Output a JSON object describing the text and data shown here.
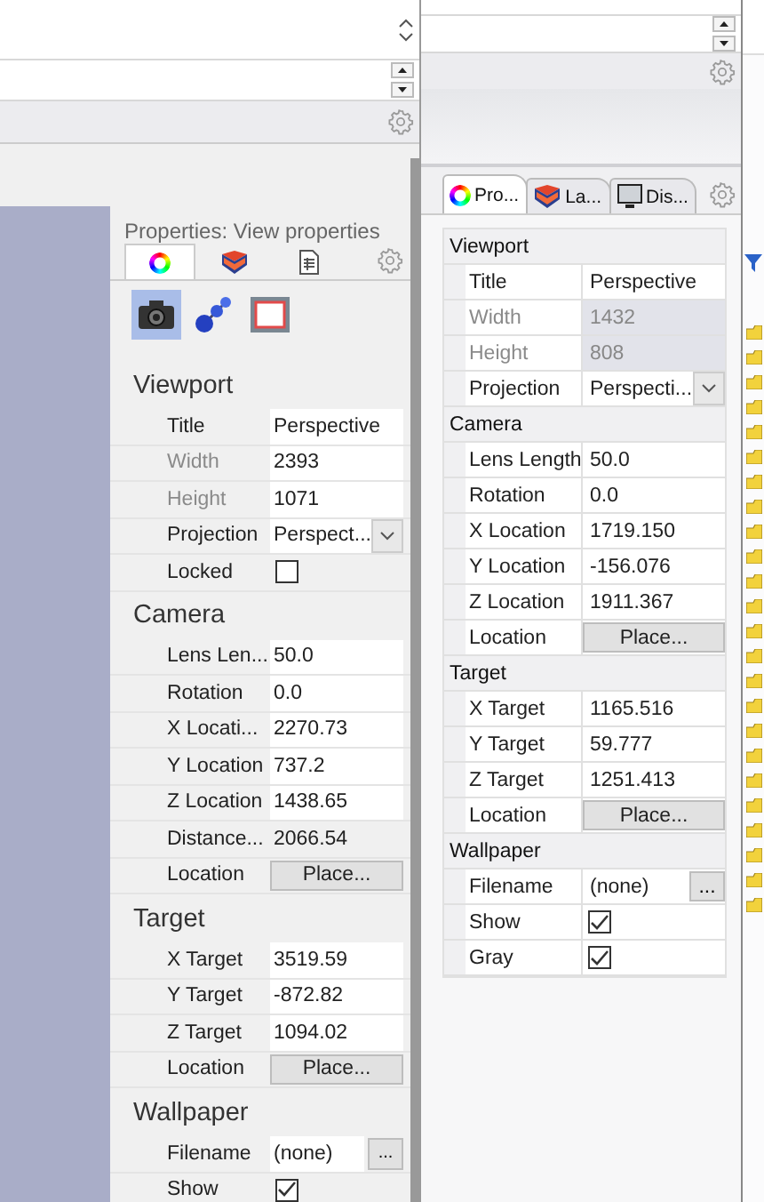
{
  "left": {
    "title": "Properties: View properties",
    "tabs": [
      {
        "selected": true
      },
      {
        "selected": false
      },
      {
        "selected": false
      }
    ],
    "subtabs": [
      {
        "selected": true
      },
      {
        "selected": false
      },
      {
        "selected": false
      }
    ],
    "sections": [
      {
        "header": "Viewport",
        "rows": [
          {
            "label": "Title",
            "kind": "text",
            "value": "Perspective",
            "disabled": false
          },
          {
            "label": "Width",
            "kind": "text",
            "value": "2393",
            "disabled": true
          },
          {
            "label": "Height",
            "kind": "text",
            "value": "1071",
            "disabled": true
          },
          {
            "label": "Projection",
            "kind": "dropdown",
            "value": "Perspect...",
            "disabled": false
          },
          {
            "label": "Locked",
            "kind": "checkbox",
            "checked": false,
            "disabled": false
          }
        ]
      },
      {
        "header": "Camera",
        "rows": [
          {
            "label": "Lens Len...",
            "kind": "text",
            "value": "50.0",
            "disabled": false
          },
          {
            "label": "Rotation",
            "kind": "text",
            "value": "0.0",
            "disabled": false
          },
          {
            "label": "X Locati...",
            "kind": "text",
            "value": "2270.73",
            "disabled": false
          },
          {
            "label": "Y Location",
            "kind": "text",
            "value": "737.2",
            "disabled": false
          },
          {
            "label": "Z Location",
            "kind": "text",
            "value": "1438.65",
            "disabled": false
          },
          {
            "label": "Distance...",
            "kind": "readonly",
            "value": "2066.54",
            "disabled": false
          },
          {
            "label": "Location",
            "kind": "button",
            "value": "Place...",
            "disabled": false
          }
        ]
      },
      {
        "header": "Target",
        "rows": [
          {
            "label": "X Target",
            "kind": "text",
            "value": "3519.59",
            "disabled": false
          },
          {
            "label": "Y Target",
            "kind": "text",
            "value": "-872.82",
            "disabled": false
          },
          {
            "label": "Z Target",
            "kind": "text",
            "value": "1094.02",
            "disabled": false
          },
          {
            "label": "Location",
            "kind": "button",
            "value": "Place...",
            "disabled": false
          }
        ]
      },
      {
        "header": "Wallpaper",
        "rows": [
          {
            "label": "Filename",
            "kind": "file",
            "value": "(none)",
            "button_label": "...",
            "disabled": false
          },
          {
            "label": "Show",
            "kind": "checkbox",
            "checked": true,
            "disabled": false
          }
        ]
      }
    ]
  },
  "right": {
    "tabs": [
      {
        "label": "Pro...",
        "selected": true
      },
      {
        "label": "La...",
        "selected": false
      },
      {
        "label": "Dis...",
        "selected": false
      }
    ],
    "sections": [
      {
        "header": "Viewport",
        "rows": [
          {
            "label": "Title",
            "kind": "text",
            "value": "Perspective",
            "disabled": false
          },
          {
            "label": "Width",
            "kind": "text",
            "value": "1432",
            "disabled": true
          },
          {
            "label": "Height",
            "kind": "text",
            "value": "808",
            "disabled": true
          },
          {
            "label": "Projection",
            "kind": "dropdown",
            "value": "Perspecti...",
            "disabled": false
          }
        ]
      },
      {
        "header": "Camera",
        "rows": [
          {
            "label": "Lens Length",
            "kind": "text",
            "value": "50.0",
            "disabled": false
          },
          {
            "label": "Rotation",
            "kind": "text",
            "value": "0.0",
            "disabled": false
          },
          {
            "label": "X Location",
            "kind": "text",
            "value": "1719.150",
            "disabled": false
          },
          {
            "label": "Y Location",
            "kind": "text",
            "value": "-156.076",
            "disabled": false
          },
          {
            "label": "Z Location",
            "kind": "text",
            "value": "1911.367",
            "disabled": false
          },
          {
            "label": "Location",
            "kind": "button",
            "value": "Place...",
            "disabled": false
          }
        ]
      },
      {
        "header": "Target",
        "rows": [
          {
            "label": "X Target",
            "kind": "text",
            "value": "1165.516",
            "disabled": false
          },
          {
            "label": "Y Target",
            "kind": "text",
            "value": "59.777",
            "disabled": false
          },
          {
            "label": "Z Target",
            "kind": "text",
            "value": "1251.413",
            "disabled": false
          },
          {
            "label": "Location",
            "kind": "button",
            "value": "Place...",
            "disabled": false
          }
        ]
      },
      {
        "header": "Wallpaper",
        "rows": [
          {
            "label": "Filename",
            "kind": "file",
            "value": "(none)",
            "button_label": "...",
            "disabled": false
          },
          {
            "label": "Show",
            "kind": "checkbox",
            "checked": true,
            "disabled": false
          },
          {
            "label": "Gray",
            "kind": "checkbox",
            "checked": true,
            "disabled": false
          }
        ]
      }
    ]
  }
}
